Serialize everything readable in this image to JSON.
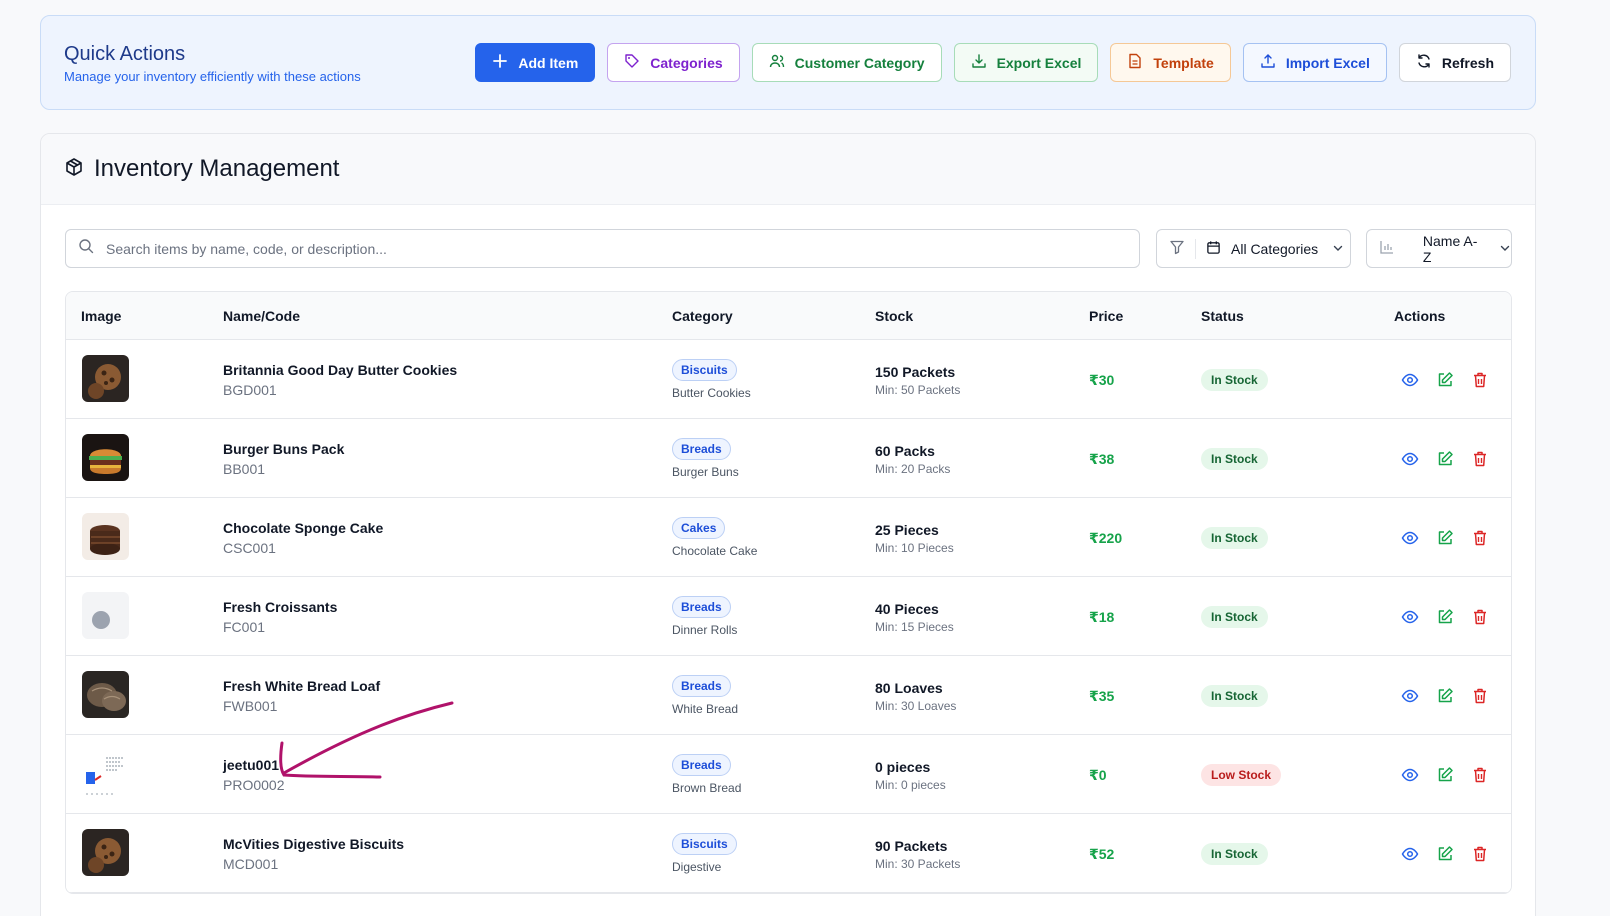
{
  "quick_actions": {
    "title": "Quick Actions",
    "subtitle": "Manage your inventory efficiently with these actions",
    "add_item": "Add Item",
    "categories": "Categories",
    "customer_category": "Customer Category",
    "export_excel": "Export Excel",
    "template": "Template",
    "import_excel": "Import Excel",
    "refresh": "Refresh"
  },
  "inventory": {
    "title": "Inventory Management",
    "search_placeholder": "Search items by name, code, or description...",
    "category_filter": "All Categories",
    "sort": "Name A-Z"
  },
  "table": {
    "headers": {
      "image": "Image",
      "name": "Name/Code",
      "category": "Category",
      "stock": "Stock",
      "price": "Price",
      "status": "Status",
      "actions": "Actions"
    },
    "rows": [
      {
        "name": "Britannia Good Day Butter Cookies",
        "code": "BGD001",
        "category": "Biscuits",
        "subcategory": "Butter Cookies",
        "stock": "150 Packets",
        "min": "Min: 50 Packets",
        "price": "₹30",
        "status": "In Stock",
        "image": "cookies"
      },
      {
        "name": "Burger Buns Pack",
        "code": "BB001",
        "category": "Breads",
        "subcategory": "Burger Buns",
        "stock": "60 Packs",
        "min": "Min: 20 Packs",
        "price": "₹38",
        "status": "In Stock",
        "image": "burger"
      },
      {
        "name": "Chocolate Sponge Cake",
        "code": "CSC001",
        "category": "Cakes",
        "subcategory": "Chocolate Cake",
        "stock": "25 Pieces",
        "min": "Min: 10 Pieces",
        "price": "₹220",
        "status": "In Stock",
        "image": "cake"
      },
      {
        "name": "Fresh Croissants",
        "code": "FC001",
        "category": "Breads",
        "subcategory": "Dinner Rolls",
        "stock": "40 Pieces",
        "min": "Min: 15 Pieces",
        "price": "₹18",
        "status": "In Stock",
        "image": "placeholder"
      },
      {
        "name": "Fresh White Bread Loaf",
        "code": "FWB001",
        "category": "Breads",
        "subcategory": "White Bread",
        "stock": "80 Loaves",
        "min": "Min: 30 Loaves",
        "price": "₹35",
        "status": "In Stock",
        "image": "bread"
      },
      {
        "name": "jeetu001",
        "code": "PRO0002",
        "category": "Breads",
        "subcategory": "Brown Bread",
        "stock": "0 pieces",
        "min": "Min: 0 pieces",
        "price": "₹0",
        "status": "Low Stock",
        "image": "doc"
      },
      {
        "name": "McVities Digestive Biscuits",
        "code": "MCD001",
        "category": "Biscuits",
        "subcategory": "Digestive",
        "stock": "90 Packets",
        "min": "Min: 30 Packets",
        "price": "₹52",
        "status": "In Stock",
        "image": "cookies"
      }
    ]
  },
  "colors": {
    "accent": "#2563eb",
    "in_stock_bg": "#e5f7ea",
    "low_stock_bg": "#fde4e4",
    "price": "#16a34a",
    "annotation": "#b0126a"
  }
}
